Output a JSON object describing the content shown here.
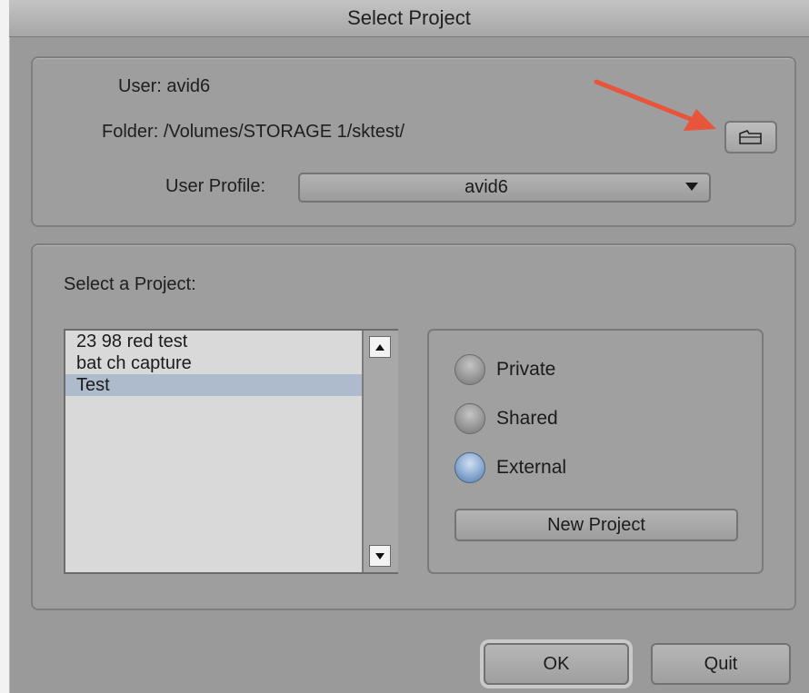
{
  "window": {
    "title": "Select Project"
  },
  "top": {
    "user_label": "User:",
    "user_value": "avid6",
    "folder_label": "Folder:",
    "folder_value": "/Volumes/STORAGE 1/sktest/",
    "profile_label": "User Profile:",
    "profile_value": "avid6",
    "folder_button_icon": "folder-icon",
    "annotation_arrow_color": "#e8553b"
  },
  "main": {
    "heading": "Select a Project:",
    "projects": [
      {
        "name": "23 98 red test",
        "selected": false
      },
      {
        "name": "bat ch capture",
        "selected": false
      },
      {
        "name": "Test",
        "selected": true
      }
    ],
    "selected_color": "#aebbcc",
    "types": [
      {
        "label": "Private",
        "checked": false
      },
      {
        "label": "Shared",
        "checked": false
      },
      {
        "label": "External",
        "checked": true
      }
    ],
    "new_project_label": "New Project"
  },
  "footer": {
    "ok_label": "OK",
    "quit_label": "Quit"
  }
}
